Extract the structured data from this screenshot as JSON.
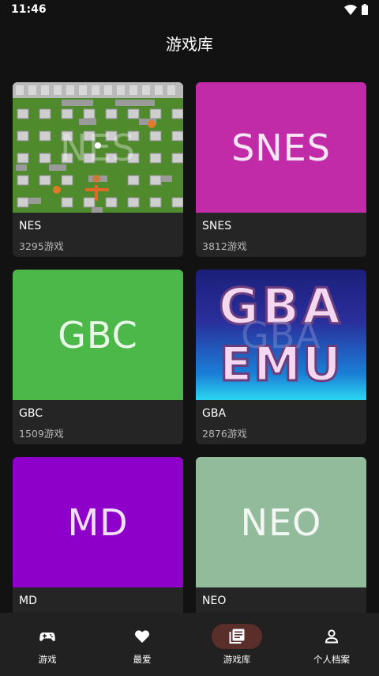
{
  "status": {
    "time": "11:46"
  },
  "page": {
    "title": "游戏库"
  },
  "consoles": [
    {
      "name": "NES",
      "count": "3295游戏",
      "cover_text": "NES",
      "cover_color": "#4f8b2c"
    },
    {
      "name": "SNES",
      "count": "3812游戏",
      "cover_text": "SNES",
      "cover_color": "#c12ba8"
    },
    {
      "name": "GBC",
      "count": "1509游戏",
      "cover_text": "GBC",
      "cover_color": "#4db84a"
    },
    {
      "name": "GBA",
      "count": "2876游戏",
      "cover_text": "GBA",
      "cover_color": "#1b1f7a",
      "logo_top": "GBA",
      "logo_bottom": "EMU"
    },
    {
      "name": "MD",
      "count": "",
      "cover_text": "MD",
      "cover_color": "#8e00c9"
    },
    {
      "name": "NEO",
      "count": "",
      "cover_text": "NEO",
      "cover_color": "#92bb9c"
    }
  ],
  "nav": [
    {
      "label": "游戏",
      "icon": "gamepad-icon",
      "active": false
    },
    {
      "label": "最爱",
      "icon": "heart-icon",
      "active": false
    },
    {
      "label": "游戏库",
      "icon": "library-icon",
      "active": true
    },
    {
      "label": "个人档案",
      "icon": "person-icon",
      "active": false
    }
  ],
  "colors": {
    "background": "#121212",
    "card": "#252525",
    "nav_bar": "#212121",
    "active_pill": "#5a2e2b"
  }
}
